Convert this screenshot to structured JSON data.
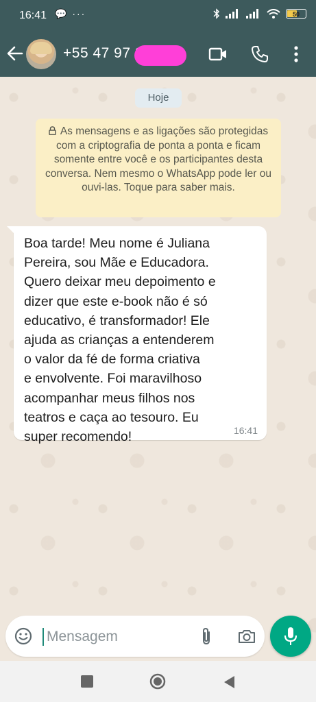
{
  "status_bar": {
    "time": "16:41",
    "left_icons": "💬 ···",
    "battery": "50"
  },
  "header": {
    "contact_name": "+55 47 97          2",
    "icons": [
      "back-arrow-icon",
      "video-call-icon",
      "phone-call-icon",
      "more-vert-icon"
    ]
  },
  "chat": {
    "date_chip": "Hoje",
    "encryption_notice": "As mensagens e as ligações são protegidas com a criptografia de ponta a ponta e ficam somente entre você e os participantes desta conversa. Nem mesmo o WhatsApp pode ler ou ouvi-las. Toque para saber mais.",
    "message": {
      "text": "Boa tarde! Meu nome é Juliana\nPereira, sou Mãe e Educadora.\nQuero deixar meu depoimento e\ndizer que este e-book não é só\neducativo, é transformador! Ele\najuda as crianças a entenderem\no valor da fé de forma criativa\ne envolvente. Foi maravilhoso\nacompanhar meus filhos nos\nteatros e caça ao tesouro. Eu\nsuper recomendo!",
      "time": "16:41"
    }
  },
  "composer": {
    "placeholder": "Mensagem",
    "value": ""
  },
  "colors": {
    "header_bg": "#3d5a5c",
    "chat_bg": "#efe7dd",
    "notice_bg": "#fbefc6",
    "accent": "#00a884",
    "redaction": "#ff3fd8"
  }
}
